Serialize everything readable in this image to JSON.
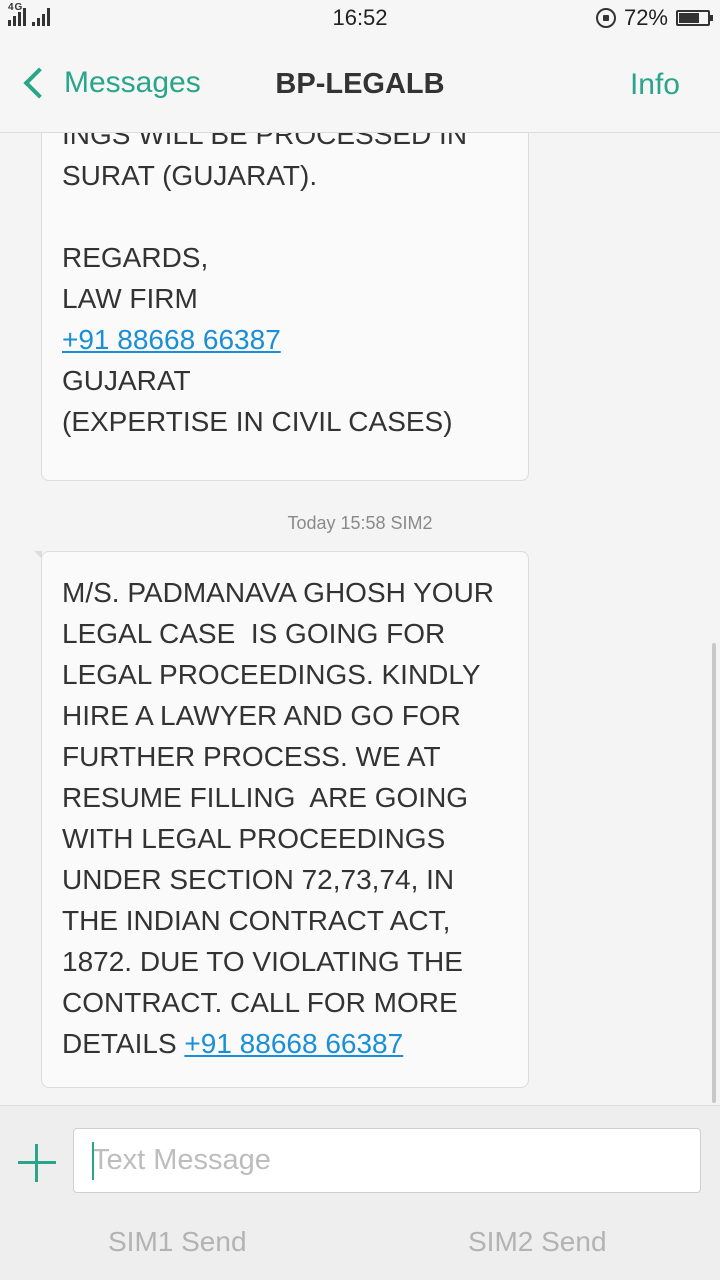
{
  "status_bar": {
    "network_tag": "4G",
    "time": "16:52",
    "battery": "72%",
    "icons": [
      "signal-icon",
      "signal-icon",
      "rotation-lock-icon",
      "battery-icon"
    ]
  },
  "nav": {
    "back_label": "Messages",
    "title": "BP-LEGALB",
    "info_label": "Info"
  },
  "messages": [
    {
      "lines": [
        "INGS WILL BE PROCESSED IN",
        "SURAT (GUJARAT).",
        "",
        "REGARDS,",
        "LAW FIRM"
      ],
      "link": "+91 88668 66387",
      "tail_lines": [
        "GUJARAT",
        "(EXPERTISE IN CIVIL CASES)"
      ]
    },
    {
      "timestamp": "Today 15:58  SIM2",
      "lines": [
        "M/S. PADMANAVA GHOSH YOUR",
        "LEGAL CASE  IS GOING FOR",
        "LEGAL PROCEEDINGS. KINDLY",
        "HIRE A LAWYER AND GO FOR",
        "FURTHER PROCESS. WE AT",
        "RESUME FILLING  ARE GOING",
        "WITH LEGAL PROCEEDINGS",
        "UNDER SECTION 72,73,74, IN",
        "THE INDIAN CONTRACT ACT,",
        "1872. DUE TO VIOLATING THE",
        "CONTRACT. CALL FOR MORE"
      ],
      "last_line_prefix": "DETAILS ",
      "link": "+91 88668 66387"
    }
  ],
  "compose": {
    "placeholder": "Text Message",
    "value": "",
    "sim1_label": "SIM1 Send",
    "sim2_label": "SIM2 Send"
  },
  "colors": {
    "accent": "#2aa58a",
    "link": "#1a8fd6",
    "bubble_bg": "#fafafa",
    "background": "#f4f4f4"
  }
}
